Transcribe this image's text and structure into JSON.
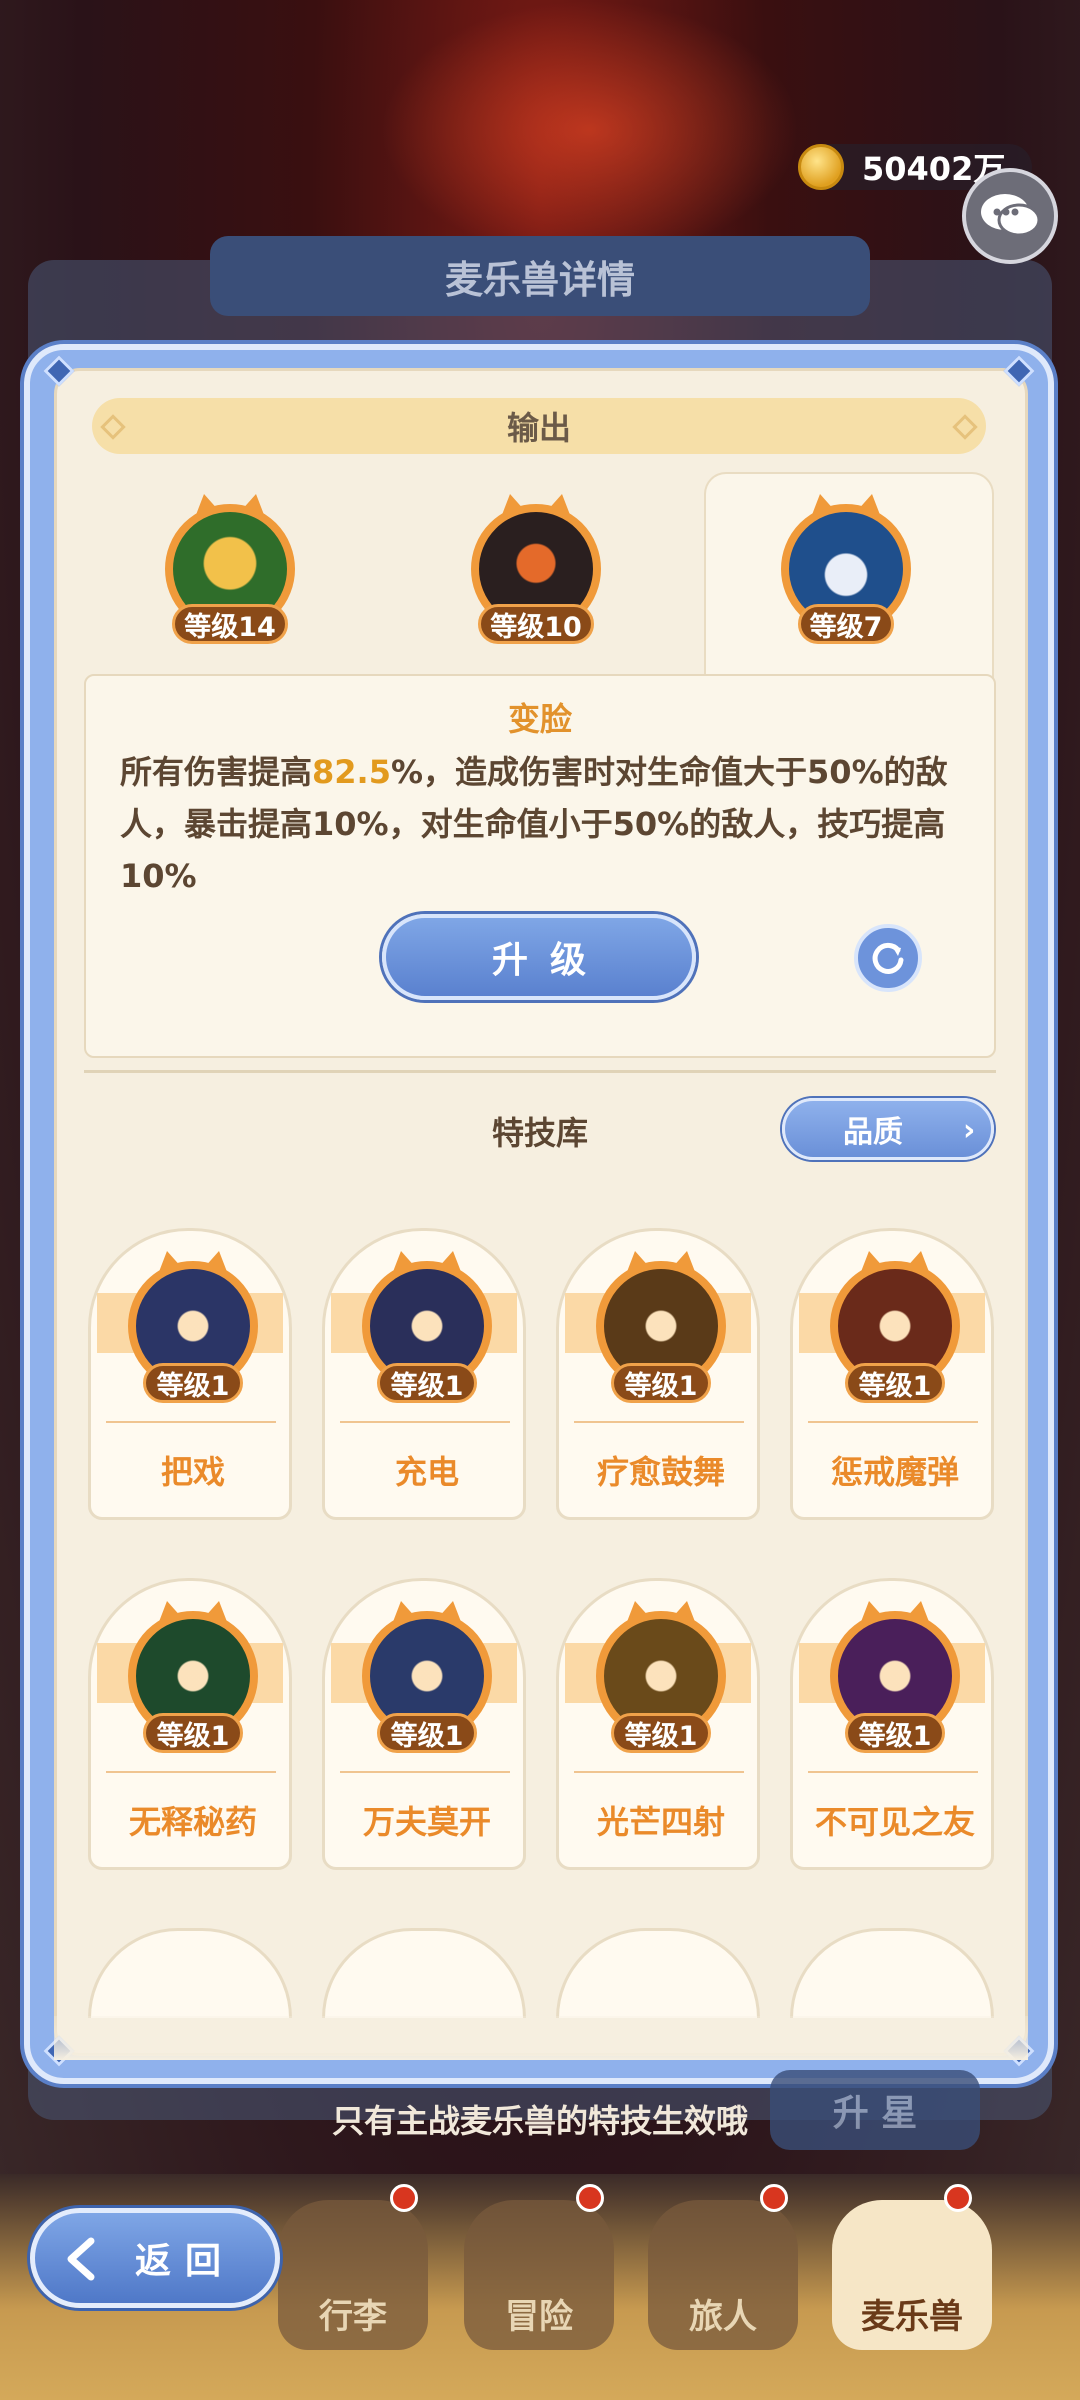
{
  "background": {
    "title": "麦乐兽详情",
    "star_label": "升 星"
  },
  "currency": {
    "amount": "50402万"
  },
  "dialog": {
    "section_title": "输出",
    "equipped_skills": [
      {
        "level": "等级14",
        "color": "#2f6d2a"
      },
      {
        "level": "等级10",
        "color": "#2a1f1f"
      },
      {
        "level": "等级7",
        "color": "#1f4f8c"
      }
    ],
    "skill_detail": {
      "name": "变脸",
      "desc_prefix": "所有伤害提高",
      "desc_highlight": "82.5",
      "desc_suffix": "%，造成伤害时对生命值大于50%的敌人，暴击提高10%，对生命值小于50%的敌人，技巧提高10%"
    },
    "upgrade_label": "升级",
    "library_title": "特技库",
    "quality_label": "品质",
    "library": [
      {
        "name": "把戏",
        "level": "等级1",
        "color": "#2b3566"
      },
      {
        "name": "充电",
        "level": "等级1",
        "color": "#2a2f5a"
      },
      {
        "name": "疗愈鼓舞",
        "level": "等级1",
        "color": "#5a3a18"
      },
      {
        "name": "惩戒魔弹",
        "level": "等级1",
        "color": "#6a2a1a"
      },
      {
        "name": "无释秘药",
        "level": "等级1",
        "color": "#1e4a2c"
      },
      {
        "name": "万夫莫开",
        "level": "等级1",
        "color": "#2a3a6a"
      },
      {
        "name": "光芒四射",
        "level": "等级1",
        "color": "#6a4a1a"
      },
      {
        "name": "不可见之友",
        "level": "等级1",
        "color": "#4a1f5a"
      }
    ]
  },
  "footer_tip": "只有主战麦乐兽的特技生效哦",
  "back_label": "返回",
  "nav": [
    {
      "label": "行李",
      "active": false
    },
    {
      "label": "冒险",
      "active": false
    },
    {
      "label": "旅人",
      "active": false
    },
    {
      "label": "麦乐兽",
      "active": true
    }
  ]
}
